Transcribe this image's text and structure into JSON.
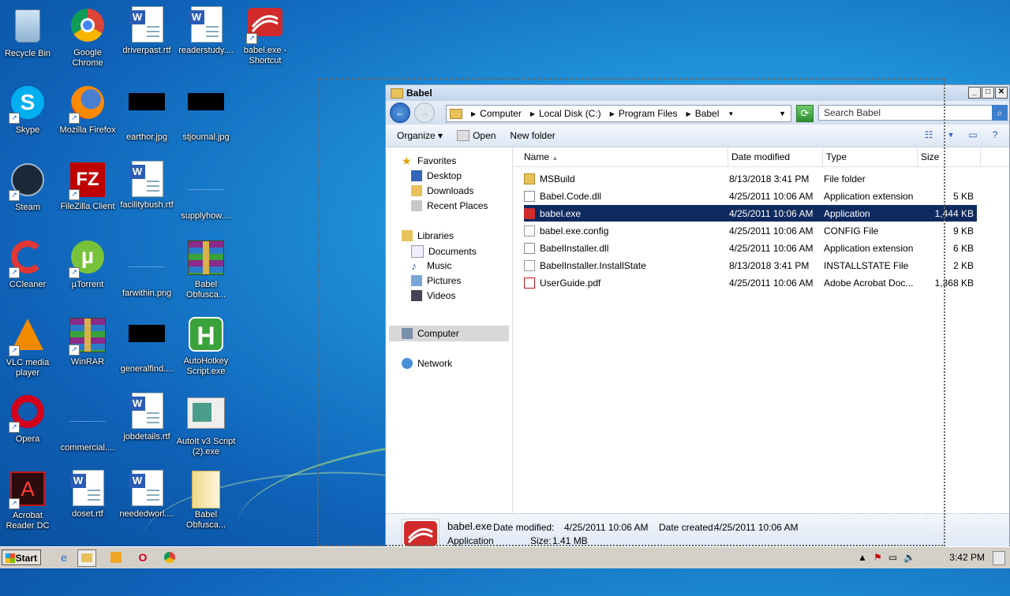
{
  "desktop": {
    "icons": [
      {
        "label": "Recycle Bin",
        "icon": "recycle-bin-icon"
      },
      {
        "label": "Google Chrome",
        "icon": "chrome-icon"
      },
      {
        "label": "driverpast.rtf",
        "icon": "word-doc-icon"
      },
      {
        "label": "readerstudy....",
        "icon": "word-doc-icon"
      },
      {
        "label": "babel.exe - Shortcut",
        "icon": "babel-icon"
      },
      {
        "label": "Skype",
        "icon": "skype-icon"
      },
      {
        "label": "Mozilla Firefox",
        "icon": "firefox-icon"
      },
      {
        "label": "earthor.jpg",
        "icon": "image-icon"
      },
      {
        "label": "stjournal.jpg",
        "icon": "image-icon"
      },
      {
        "label": "Steam",
        "icon": "steam-icon"
      },
      {
        "label": "FileZilla Client",
        "icon": "filezilla-icon"
      },
      {
        "label": "facilitybush.rtf",
        "icon": "word-doc-icon"
      },
      {
        "label": "supplyhow....",
        "icon": "blank-file-icon"
      },
      {
        "label": "CCleaner",
        "icon": "ccleaner-icon"
      },
      {
        "label": "µTorrent",
        "icon": "utorrent-icon"
      },
      {
        "label": "farwithin.png",
        "icon": "blank-file-icon"
      },
      {
        "label": "Babel Obfusca...",
        "icon": "winrar-icon"
      },
      {
        "label": "VLC media player",
        "icon": "vlc-icon"
      },
      {
        "label": "WinRAR",
        "icon": "winrar-icon"
      },
      {
        "label": "generalfind....",
        "icon": "image-icon"
      },
      {
        "label": "AutoHotkey Script.exe",
        "icon": "autohotkey-icon"
      },
      {
        "label": "Opera",
        "icon": "opera-icon"
      },
      {
        "label": "commercial....",
        "icon": "blank-file-icon"
      },
      {
        "label": "jobdetails.rtf",
        "icon": "word-doc-icon"
      },
      {
        "label": "AutoIt v3 Script (2).exe",
        "icon": "autoit-icon"
      },
      {
        "label": "Acrobat Reader DC",
        "icon": "acrobat-icon"
      },
      {
        "label": "doset.rtf",
        "icon": "word-doc-icon"
      },
      {
        "label": "neededworl....",
        "icon": "word-doc-icon"
      },
      {
        "label": "Babel Obfusca...",
        "icon": "folder-icon"
      }
    ]
  },
  "explorer": {
    "title": "Babel",
    "breadcrumb": [
      "Computer",
      "Local Disk (C:)",
      "Program Files",
      "Babel"
    ],
    "search_placeholder": "Search Babel",
    "toolbar": {
      "organize": "Organize",
      "open": "Open",
      "new_folder": "New folder"
    },
    "nav": {
      "favorites": "Favorites",
      "desktop": "Desktop",
      "downloads": "Downloads",
      "recent": "Recent Places",
      "libraries": "Libraries",
      "documents": "Documents",
      "music": "Music",
      "pictures": "Pictures",
      "videos": "Videos",
      "computer": "Computer",
      "network": "Network"
    },
    "columns": {
      "name": "Name",
      "date": "Date modified",
      "type": "Type",
      "size": "Size"
    },
    "files": [
      {
        "name": "MSBuild",
        "date": "8/13/2018 3:41 PM",
        "type": "File folder",
        "size": "",
        "icon": "folder-icon"
      },
      {
        "name": "Babel.Code.dll",
        "date": "4/25/2011 10:06 AM",
        "type": "Application extension",
        "size": "5 KB",
        "icon": "dll-icon"
      },
      {
        "name": "babel.exe",
        "date": "4/25/2011 10:06 AM",
        "type": "Application",
        "size": "1,444 KB",
        "icon": "babel-icon"
      },
      {
        "name": "babel.exe.config",
        "date": "4/25/2011 10:06 AM",
        "type": "CONFIG File",
        "size": "9 KB",
        "icon": "file-icon"
      },
      {
        "name": "BabelInstaller.dll",
        "date": "4/25/2011 10:06 AM",
        "type": "Application extension",
        "size": "6 KB",
        "icon": "dll-icon"
      },
      {
        "name": "BabelInstaller.InstallState",
        "date": "8/13/2018 3:41 PM",
        "type": "INSTALLSTATE File",
        "size": "2 KB",
        "icon": "file-icon"
      },
      {
        "name": "UserGuide.pdf",
        "date": "4/25/2011 10:06 AM",
        "type": "Adobe Acrobat Doc...",
        "size": "1,368 KB",
        "icon": "pdf-icon"
      }
    ],
    "details": {
      "name": "babel.exe",
      "modified_label": "Date modified:",
      "modified": "4/25/2011 10:06 AM",
      "created_label": "Date created:",
      "created": "4/25/2011 10:06 AM",
      "type": "Application",
      "size_label": "Size:",
      "size": "1.41 MB"
    }
  },
  "taskbar": {
    "start": "Start",
    "clock": "3:42 PM"
  },
  "watermark": "ANY RUN"
}
